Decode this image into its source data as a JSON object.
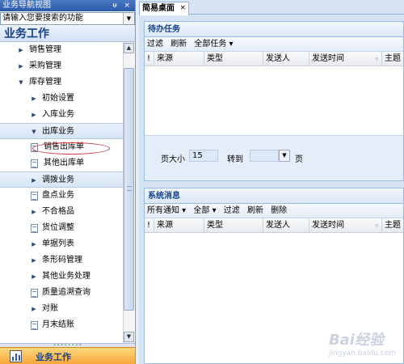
{
  "nav": {
    "header_title": "业务导航视图",
    "header_buttons": "ᵾ ×",
    "search_placeholder": "请输入您要搜索的功能",
    "section_title": "业务工作",
    "items": [
      {
        "label": "销售管理",
        "type": "arrow-right",
        "level": 1
      },
      {
        "label": "采购管理",
        "type": "arrow-right",
        "level": 1
      },
      {
        "label": "库存管理",
        "type": "arrow-down",
        "level": 1
      },
      {
        "label": "初始设置",
        "type": "arrow-right",
        "level": 2
      },
      {
        "label": "入库业务",
        "type": "arrow-right",
        "level": 2
      },
      {
        "label": "出库业务",
        "type": "arrow-down",
        "level": 2,
        "highlighted": true
      },
      {
        "label": "销售出库单",
        "type": "doc",
        "level": 3,
        "circled": true
      },
      {
        "label": "其他出库单",
        "type": "doc",
        "level": 3
      },
      {
        "label": "调拨业务",
        "type": "arrow-right",
        "level": 2,
        "highlighted": true
      },
      {
        "label": "盘点业务",
        "type": "doc",
        "level": 2
      },
      {
        "label": "不合格品",
        "type": "arrow-right",
        "level": 2
      },
      {
        "label": "货位调整",
        "type": "doc",
        "level": 2
      },
      {
        "label": "单据列表",
        "type": "arrow-right",
        "level": 2
      },
      {
        "label": "条形码管理",
        "type": "arrow-right",
        "level": 2
      },
      {
        "label": "其他业务处理",
        "type": "arrow-right",
        "level": 2
      },
      {
        "label": "质量追溯查询",
        "type": "doc",
        "level": 2
      },
      {
        "label": "对账",
        "type": "arrow-right",
        "level": 2
      },
      {
        "label": "月末结账",
        "type": "doc",
        "level": 2
      }
    ],
    "bottom_label": "业务工作"
  },
  "tabs": [
    {
      "label": "简易桌面",
      "close": "×"
    }
  ],
  "todo": {
    "title": "待办任务",
    "toolbar": [
      "过滤",
      "刷新",
      "全部任务 ▾"
    ],
    "columns": [
      "!",
      "来源",
      "类型",
      "发送人",
      "发送时间",
      "主题"
    ],
    "pager": {
      "page_size_label": "页大小",
      "page_size_value": "15",
      "goto_label": "转到",
      "goto_value": "",
      "page_label": "页"
    }
  },
  "messages": {
    "title": "系统消息",
    "toolbar": [
      "所有通知 ▾",
      "全部 ▾",
      "过滤",
      "刷新",
      "删除"
    ],
    "columns": [
      "!",
      "来源",
      "类型",
      "发送人",
      "发送时间",
      "主题"
    ]
  },
  "watermark": {
    "text": "Bai经验",
    "sub": "jingyan.baidu.com"
  },
  "colors": {
    "accent": "#15428b",
    "nav_bottom": "#f7a83a",
    "circle": "#d43b3b"
  }
}
